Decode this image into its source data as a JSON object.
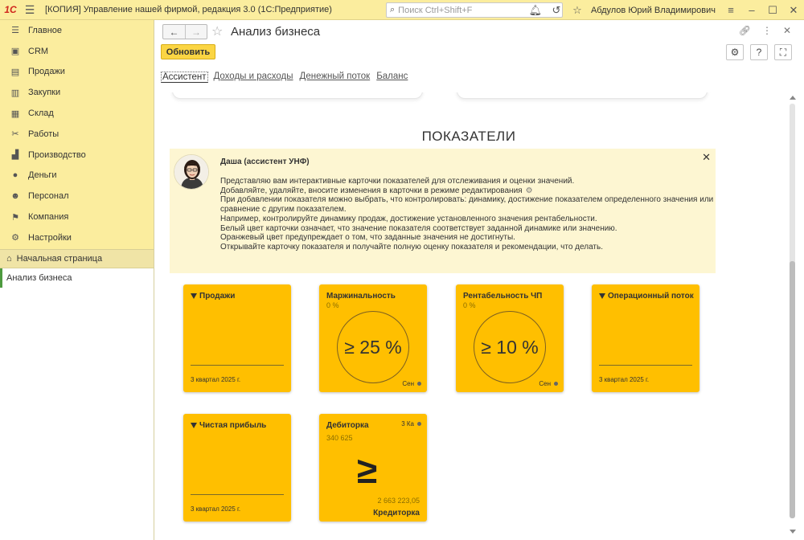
{
  "titlebar": {
    "logo": "1С",
    "app_title": "[КОПИЯ] Управление нашей фирмой, редакция 3.0  (1С:Предприятие)",
    "search_placeholder": "Поиск Ctrl+Shift+F",
    "user_name": "Абдулов Юрий Владимирович"
  },
  "sidebar": {
    "items": [
      {
        "label": "Главное",
        "icon": "list-icon"
      },
      {
        "label": "CRM",
        "icon": "crm-icon"
      },
      {
        "label": "Продажи",
        "icon": "cart-icon"
      },
      {
        "label": "Закупки",
        "icon": "basket-icon"
      },
      {
        "label": "Склад",
        "icon": "warehouse-icon"
      },
      {
        "label": "Работы",
        "icon": "tools-icon"
      },
      {
        "label": "Производство",
        "icon": "factory-icon"
      },
      {
        "label": "Деньги",
        "icon": "money-icon"
      },
      {
        "label": "Персонал",
        "icon": "people-icon"
      },
      {
        "label": "Компания",
        "icon": "flag-icon"
      },
      {
        "label": "Настройки",
        "icon": "gear-icon"
      }
    ],
    "home": "Начальная страница",
    "open_tab": "Анализ бизнеса"
  },
  "main": {
    "title": "Анализ бизнеса",
    "refresh_label": "Обновить",
    "tabs": [
      "Ассистент",
      "Доходы и расходы",
      "Денежный поток",
      "Баланс"
    ],
    "section_title": "ПОКАЗАТЕЛИ"
  },
  "assistant": {
    "name": "Даша (ассистент УНФ)",
    "lines": [
      "Представляю вам интерактивные карточки показателей для отслеживания и оценки значений.",
      "Добавляйте, удаляйте, вносите изменения в карточки в режиме редактирования",
      "При  добавлении показателя можно выбрать, что контролировать: динамику, достижение показателем определенного значения или",
      "сравнение с другим показателем.",
      "Например, контролируйте динамику продаж, достижение установленного значения рентабельности.",
      "Белый цвет карточки означает, что значение показателя соответствует заданной динамике или значению.",
      "Оранжевый цвет предупреждает о том, что заданные значения не достигнуты.",
      "Открывайте карточку показателя и получайте полную оценку показателя и рекомендации, что делать."
    ]
  },
  "kpis": {
    "sales": {
      "title": "Продажи",
      "period": "3 квартал 2025 г."
    },
    "margin": {
      "title": "Маржинальность",
      "value": "0 %",
      "target": "≥ 25 %",
      "label": "Сен"
    },
    "profitability": {
      "title": "Рентабельность ЧП",
      "value": "0 %",
      "target": "≥ 10 %",
      "label": "Сен"
    },
    "opflow": {
      "title": "Операционный поток",
      "period": "3 квартал 2025 г."
    },
    "netprofit": {
      "title": "Чистая прибыль",
      "period": "3 квартал 2025 г."
    },
    "receivables": {
      "title": "Дебиторка",
      "value": "340 625",
      "tr_label": "3 Ка",
      "symbol": "≥",
      "amount": "2 663 223,05",
      "compare": "Кредиторка"
    }
  }
}
